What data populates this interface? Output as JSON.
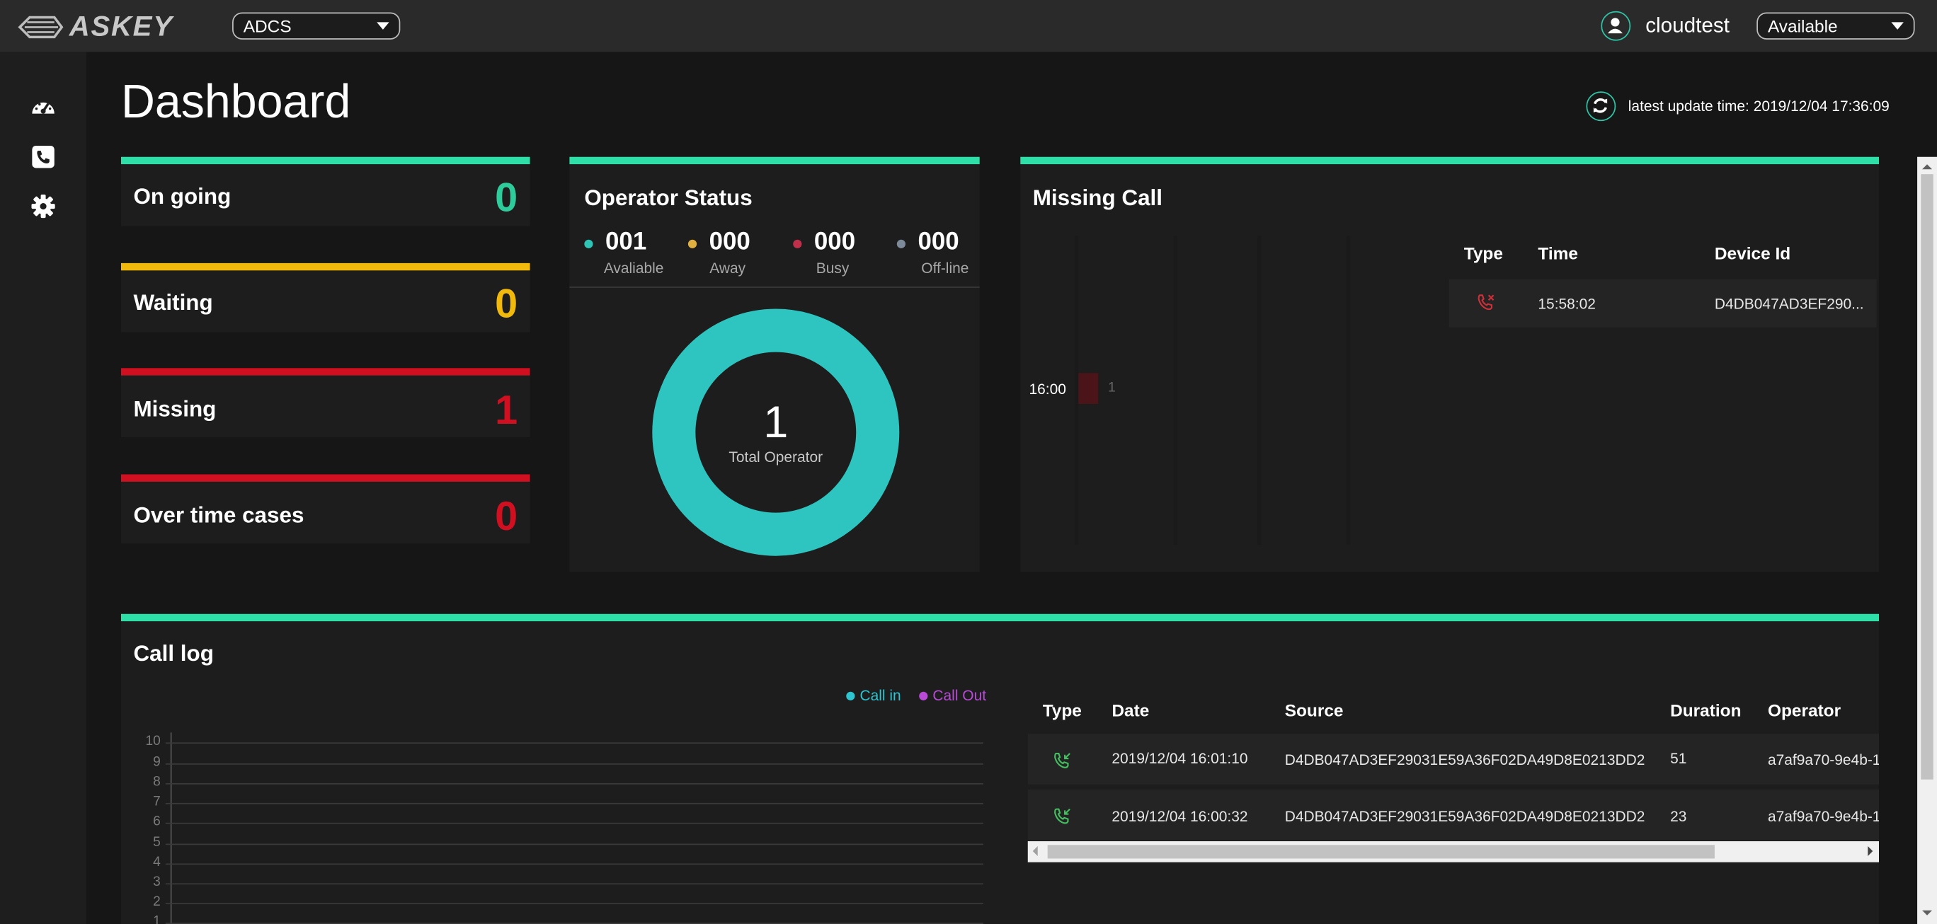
{
  "header": {
    "logo_text": "ASKEY",
    "project_select": "ADCS",
    "username": "cloudtest",
    "status_select": "Available"
  },
  "sidebar": {
    "icons": [
      "dashboard-icon",
      "phone-icon",
      "gear-icon"
    ]
  },
  "page": {
    "title": "Dashboard",
    "update_text": "latest update time: 2019/12/04 17:36:09"
  },
  "stats": [
    {
      "label": "On going",
      "value": "0",
      "color": "#2ecc9a"
    },
    {
      "label": "Waiting",
      "value": "0",
      "color": "#f2b90d"
    },
    {
      "label": "Missing",
      "value": "1",
      "color": "#d01020"
    },
    {
      "label": "Over time cases",
      "value": "0",
      "color": "#d01020"
    }
  ],
  "operator_status": {
    "title": "Operator Status",
    "items": [
      {
        "value": "001",
        "label": "Avaliable",
        "color": "#2ec4b6"
      },
      {
        "value": "000",
        "label": "Away",
        "color": "#e0b040"
      },
      {
        "value": "000",
        "label": "Busy",
        "color": "#c0304a"
      },
      {
        "value": "000",
        "label": "Off-line",
        "color": "#7d8a99"
      }
    ],
    "total": "1",
    "total_label": "Total Operator"
  },
  "missing_call": {
    "title": "Missing Call",
    "chart_time": "16:00",
    "chart_value": "1",
    "table_headers": [
      "Type",
      "Time",
      "Device Id"
    ],
    "rows": [
      {
        "type_icon": "missed-call-icon",
        "time": "15:58:02",
        "device_id": "D4DB047AD3EF290..."
      }
    ]
  },
  "call_log": {
    "title": "Call log",
    "legend": [
      {
        "label": "Call in",
        "color": "#2ec4d0"
      },
      {
        "label": "Call Out",
        "color": "#b84ad6"
      }
    ],
    "y_ticks": [
      "10",
      "9",
      "8",
      "7",
      "6",
      "5",
      "4",
      "3",
      "2",
      "1"
    ],
    "table_headers": [
      "Type",
      "Date",
      "Source",
      "Duration",
      "Operator"
    ],
    "rows": [
      {
        "type_icon": "incoming-call-icon",
        "date": "2019/12/04 16:01:10",
        "source": "D4DB047AD3EF29031E59A36F02DA49D8E0213DD2",
        "duration": "51",
        "operator": "a7af9a70-9e4b-1"
      },
      {
        "type_icon": "incoming-call-icon",
        "date": "2019/12/04 16:00:32",
        "source": "D4DB047AD3EF29031E59A36F02DA49D8E0213DD2",
        "duration": "23",
        "operator": "a7af9a70-9e4b-1"
      }
    ]
  },
  "colors": {
    "accent": "#2ee0a8",
    "teal": "#2ec4c0",
    "missed": "#d0303a",
    "incoming": "#44c060"
  }
}
